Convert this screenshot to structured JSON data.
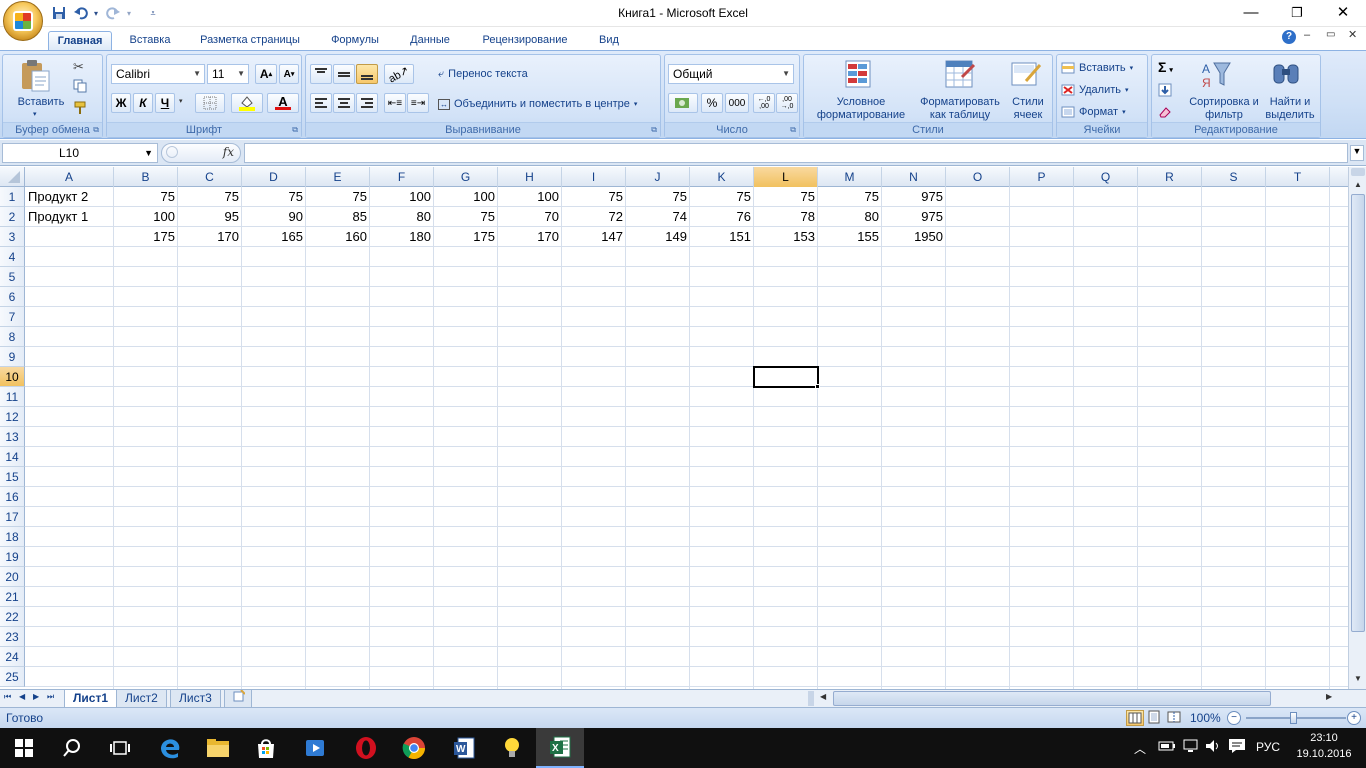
{
  "window": {
    "title": "Книга1 - Microsoft Excel",
    "minimize": "—",
    "restore": "❐",
    "close": "✕"
  },
  "tabs": [
    "Главная",
    "Вставка",
    "Разметка страницы",
    "Формулы",
    "Данные",
    "Рецензирование",
    "Вид"
  ],
  "ribbon": {
    "clipboard": {
      "label": "Буфер обмена",
      "paste": "Вставить"
    },
    "font": {
      "label": "Шрифт",
      "name": "Calibri",
      "size": "11",
      "bold": "Ж",
      "italic": "К",
      "underline": "Ч",
      "grow": "A",
      "shrink": "A",
      "color_letter": "A"
    },
    "alignment": {
      "label": "Выравнивание",
      "wrap": "Перенос текста",
      "merge": "Объединить и поместить в центре"
    },
    "number": {
      "label": "Число",
      "format": "Общий",
      "percent": "%",
      "thousands": "000",
      "inc_decimal": "←,0 ,00",
      "dec_decimal": ",00 →,0"
    },
    "styles": {
      "label": "Стили",
      "conditional": "Условное форматирование",
      "as_table": "Форматировать как таблицу",
      "cell_styles": "Стили ячеек"
    },
    "cells": {
      "label": "Ячейки",
      "insert": "Вставить",
      "delete": "Удалить",
      "format": "Формат"
    },
    "editing": {
      "label": "Редактирование",
      "sort": "Сортировка и фильтр",
      "find": "Найти и выделить",
      "sum": "Σ"
    }
  },
  "formula_bar": {
    "name_box": "L10",
    "fx": "fx",
    "formula": ""
  },
  "columns": [
    "A",
    "B",
    "C",
    "D",
    "E",
    "F",
    "G",
    "H",
    "I",
    "J",
    "K",
    "L",
    "M",
    "N",
    "O",
    "P",
    "Q",
    "R",
    "S",
    "T"
  ],
  "rows": [
    "1",
    "2",
    "3",
    "4",
    "5",
    "6",
    "7",
    "8",
    "9",
    "10",
    "11",
    "12",
    "13",
    "14",
    "15",
    "16",
    "17",
    "18",
    "19",
    "20",
    "21",
    "22",
    "23",
    "24",
    "25"
  ],
  "selected": {
    "column": "L",
    "row": "10"
  },
  "cells": {
    "r1": [
      "Продукт 2",
      "75",
      "75",
      "75",
      "75",
      "100",
      "100",
      "100",
      "75",
      "75",
      "75",
      "75",
      "75",
      "975"
    ],
    "r2": [
      "Продукт 1",
      "100",
      "95",
      "90",
      "85",
      "80",
      "75",
      "70",
      "72",
      "74",
      "76",
      "78",
      "80",
      "975"
    ],
    "r3": [
      "",
      "175",
      "170",
      "165",
      "160",
      "180",
      "175",
      "170",
      "147",
      "149",
      "151",
      "153",
      "155",
      "1950"
    ]
  },
  "sheets": [
    "Лист1",
    "Лист2",
    "Лист3"
  ],
  "status": {
    "ready": "Готово",
    "zoom": "100%"
  },
  "taskbar": {
    "lang": "РУС",
    "time": "23:10",
    "date": "19.10.2016"
  },
  "colors": {
    "ribbon": "#dfeafa",
    "accent": "#15428b",
    "selected_header": "#f9d99f",
    "taskbar": "#101010",
    "excel_green": "#1e7145"
  }
}
